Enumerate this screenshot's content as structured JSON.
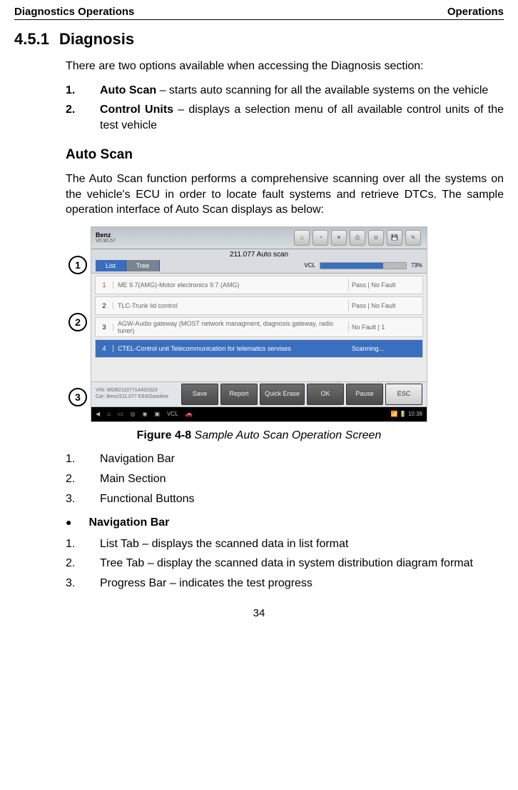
{
  "header": {
    "left": "Diagnostics Operations",
    "right": "Operations"
  },
  "h451": {
    "num": "4.5.1",
    "title": "Diagnosis"
  },
  "intro": "There are two options available when accessing the Diagnosis section:",
  "opt1": {
    "marker": "1.",
    "lead": "Auto Scan",
    "rest": " – starts auto scanning for all the available systems on the vehicle"
  },
  "opt2": {
    "marker": "2.",
    "lead": "Control Units",
    "rest": " – displays a selection menu of all available control units of the test vehicle"
  },
  "subtitle1": "Auto Scan",
  "autoscan_desc": "The Auto Scan function performs a comprehensive scanning over all the systems on the vehicle's ECU in order to locate fault systems and retrieve DTCs. The sample operation interface of Auto Scan displays as below:",
  "fig": {
    "brand": "Benz",
    "brand_sub": "V0.90.57",
    "scan_title": "211.077 Auto scan",
    "tabs": {
      "list": "List",
      "tree": "Tree"
    },
    "vcl": "VCL",
    "pct": "73%",
    "rows": [
      {
        "idx": "1",
        "desc": "ME 9.7(AMG)-Motor electronics 9.7 (AMG)",
        "stat": "Pass | No Fault"
      },
      {
        "idx": "2",
        "desc": "TLC-Trunk lid control",
        "stat": "Pass | No Fault"
      },
      {
        "idx": "3",
        "desc": "AGW-Audio gateway (MOST network managment, diagnosis gateway, radio tuner)",
        "stat": "No Fault | 1"
      },
      {
        "idx": "4",
        "desc": "CTEL-Control unit Telecommunication for telematics servises",
        "stat": "Scanning..."
      }
    ],
    "meta1": "VIN: WDB2110771A432323",
    "meta2": "Car: Benz/211.077 E63/Gasoline",
    "buttons": {
      "save": "Save",
      "report": "Report",
      "erase": "Quick Erase",
      "ok": "OK",
      "pause": "Pause",
      "esc": "ESC"
    },
    "time": "10:38"
  },
  "caption": {
    "b": "Figure 4-8",
    "it": " Sample Auto Scan Operation Screen"
  },
  "leg": {
    "a": "1.",
    "at": "Navigation Bar",
    "b": "2.",
    "bt": "Main Section",
    "c": "3.",
    "ct": "Functional Buttons"
  },
  "bullet1": "Navigation Bar",
  "nav1": {
    "m": "1.",
    "t": "List Tab – displays the scanned data in list format"
  },
  "nav2": {
    "m": "2.",
    "t": "Tree Tab – display the scanned data in system distribution diagram format"
  },
  "nav3": {
    "m": "3.",
    "t": "Progress Bar – indicates the test progress"
  },
  "page_num": "34",
  "annots": {
    "a1": "1",
    "a2": "2",
    "a3": "3"
  }
}
